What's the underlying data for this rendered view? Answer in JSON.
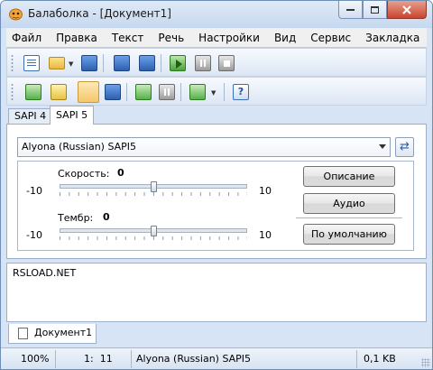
{
  "window": {
    "title": "Балаболка - [Документ1]"
  },
  "menu": [
    "Файл",
    "Правка",
    "Текст",
    "Речь",
    "Настройки",
    "Вид",
    "Сервис",
    "Закладка",
    "?"
  ],
  "toolbar": {
    "row1_icons": [
      "new-document-icon",
      "open-folder-icon",
      "save-audio-icon",
      "convert-icon",
      "export-icon",
      "play-icon",
      "pause-icon",
      "stop-icon"
    ],
    "row2_icons": [
      "split-icon",
      "batch-icon",
      "clipboard-reader-icon",
      "voice-settings-icon",
      "insert-icon",
      "paste-icon",
      "tools-icon",
      "help-icon"
    ],
    "help_glyph": "?"
  },
  "tabs": [
    {
      "label": "SAPI 4",
      "active": false
    },
    {
      "label": "SAPI 5",
      "active": true
    }
  ],
  "voice": {
    "selected": "Alyona (Russian) SAPI5"
  },
  "sliders": {
    "speed": {
      "label": "Скорость:",
      "value": "0",
      "min": "-10",
      "max": "10",
      "fraction": 0.5
    },
    "pitch": {
      "label": "Тембр:",
      "value": "0",
      "min": "-10",
      "max": "10",
      "fraction": 0.5
    }
  },
  "buttons": {
    "description": "Описание",
    "audio": "Аудио",
    "defaults": "По умолчанию"
  },
  "editor": {
    "text": "RSLOAD.NET"
  },
  "document_tab": {
    "label": "Документ1"
  },
  "status": {
    "zoom": "100%",
    "position": "1:  11",
    "voice": "Alyona (Russian) SAPI5",
    "size": "0,1 KB"
  },
  "colors": {
    "frame": "#d6e4f5",
    "accent": "#3d6fb8"
  }
}
